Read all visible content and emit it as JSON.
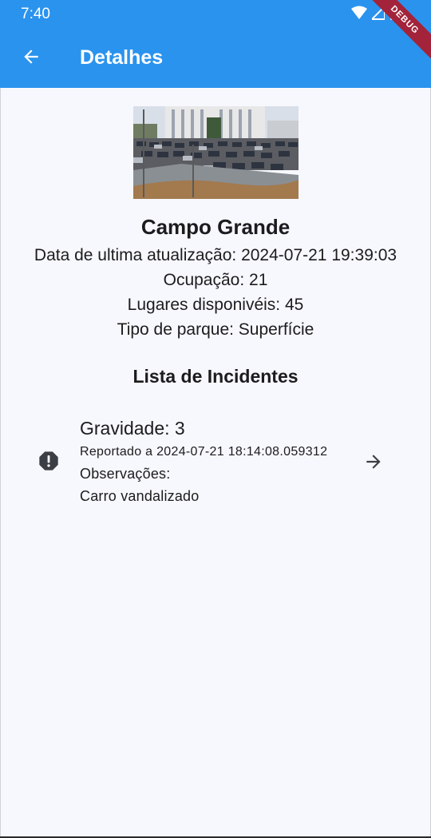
{
  "status_bar": {
    "time": "7:40"
  },
  "app_bar": {
    "title": "Detalhes",
    "debug_label": "DEBUG",
    "color": "#2a93ee"
  },
  "park": {
    "name": "Campo Grande",
    "last_update": "Data de ultima atualização: 2024-07-21 19:39:03",
    "occupation": "Ocupação: 21",
    "available": "Lugares disponivéis: 45",
    "type": "Tipo de parque: Superfície"
  },
  "incidents_section": {
    "title": "Lista de Incidentes",
    "items": [
      {
        "severity": "Gravidade: 3",
        "reported": "Reportado a 2024-07-21 18:14:08.059312",
        "observations_label": "Observações:",
        "observations": "Carro vandalizado",
        "icon": "alert-octagon-icon",
        "action_icon": "arrow-right-icon"
      }
    ]
  }
}
